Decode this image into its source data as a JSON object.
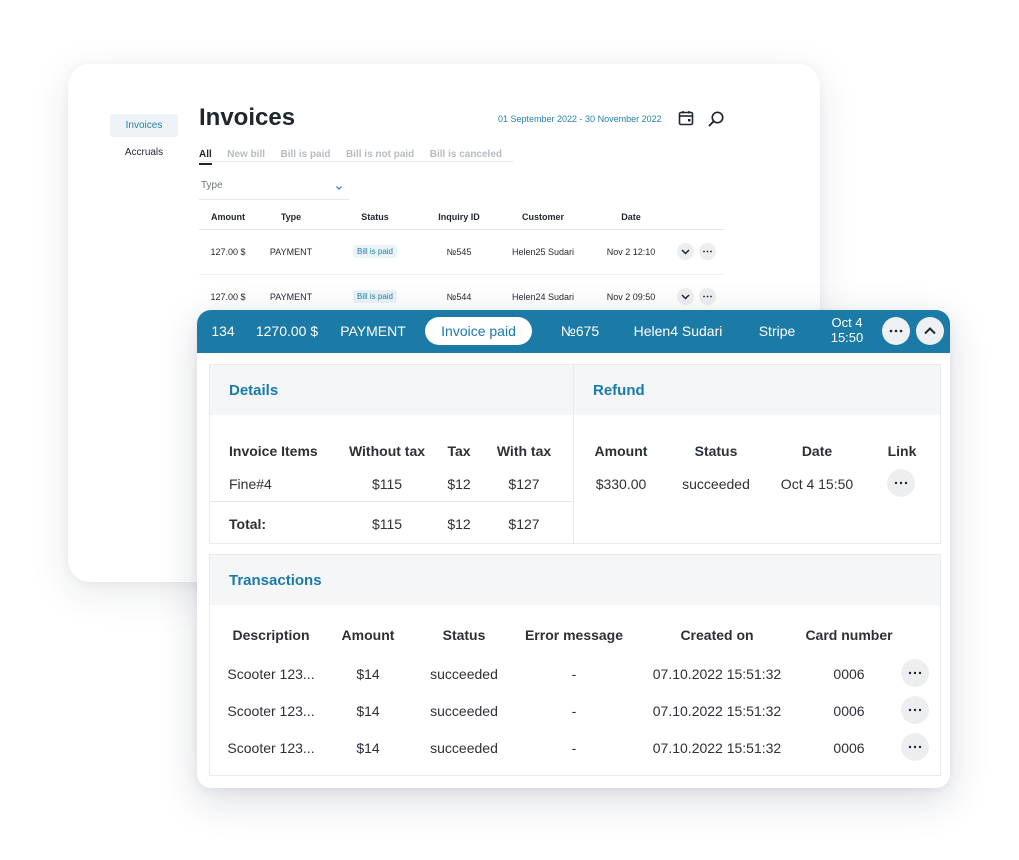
{
  "sidebar": {
    "items": [
      {
        "label": "Invoices",
        "active": true
      },
      {
        "label": "Accruals",
        "active": false
      }
    ]
  },
  "page": {
    "title": "Invoices",
    "date_range": "01 September 2022 - 30 November 2022",
    "icons": [
      "calendar-icon",
      "search-icon"
    ]
  },
  "filters": {
    "tabs": [
      "All",
      "New bill",
      "Bill is paid",
      "Bill is not paid",
      "Bill is canceled"
    ],
    "active_tab": "All",
    "type_select": {
      "placeholder": "Type"
    }
  },
  "invoice_list": {
    "columns": [
      "Amount",
      "Type",
      "Status",
      "Inquiry ID",
      "Customer",
      "Date"
    ],
    "rows": [
      {
        "amount": "127.00 $",
        "type": "PAYMENT",
        "status": "Bill is paid",
        "inquiry": "№545",
        "customer": "Helen25 Sudari",
        "date": "Nov 2 12:10"
      },
      {
        "amount": "127.00 $",
        "type": "PAYMENT",
        "status": "Bill is paid",
        "inquiry": "№544",
        "customer": "Helen24 Sudari",
        "date": "Nov 2 09:50"
      }
    ]
  },
  "expanded_invoice": {
    "id": "134",
    "amount": "1270.00 $",
    "type": "PAYMENT",
    "status": "Invoice paid",
    "inquiry": "№675",
    "customer": "Helen4 Sudari",
    "provider": "Stripe",
    "date_line1": "Oct 4",
    "date_line2": "15:50"
  },
  "details": {
    "title": "Details",
    "columns": [
      "Invoice Items",
      "Without tax",
      "Tax",
      "With tax"
    ],
    "rows": [
      {
        "item": "Fine#4",
        "without_tax": "$115",
        "tax": "$12",
        "with_tax": "$127"
      }
    ],
    "total": {
      "label": "Total:",
      "without_tax": "$115",
      "tax": "$12",
      "with_tax": "$127"
    }
  },
  "refund": {
    "title": "Refund",
    "columns": [
      "Amount",
      "Status",
      "Date",
      "Link"
    ],
    "rows": [
      {
        "amount": "$330.00",
        "status": "succeeded",
        "date": "Oct 4 15:50"
      }
    ]
  },
  "transactions": {
    "title": "Transactions",
    "columns": [
      "Description",
      "Amount",
      "Status",
      "Error message",
      "Created on",
      "Card number"
    ],
    "rows": [
      {
        "description": "Scooter 123...",
        "amount": "$14",
        "status": "succeeded",
        "error": "-",
        "created": "07.10.2022 15:51:32",
        "card": "0006"
      },
      {
        "description": "Scooter 123...",
        "amount": "$14",
        "status": "succeeded",
        "error": "-",
        "created": "07.10.2022 15:51:32",
        "card": "0006"
      },
      {
        "description": "Scooter 123...",
        "amount": "$14",
        "status": "succeeded",
        "error": "-",
        "created": "07.10.2022 15:51:32",
        "card": "0006"
      }
    ]
  },
  "colors": {
    "accent": "#1b7aa6",
    "link": "#2480a6",
    "panel_head": "#f4f6f8",
    "button_bg": "#eceef0"
  }
}
